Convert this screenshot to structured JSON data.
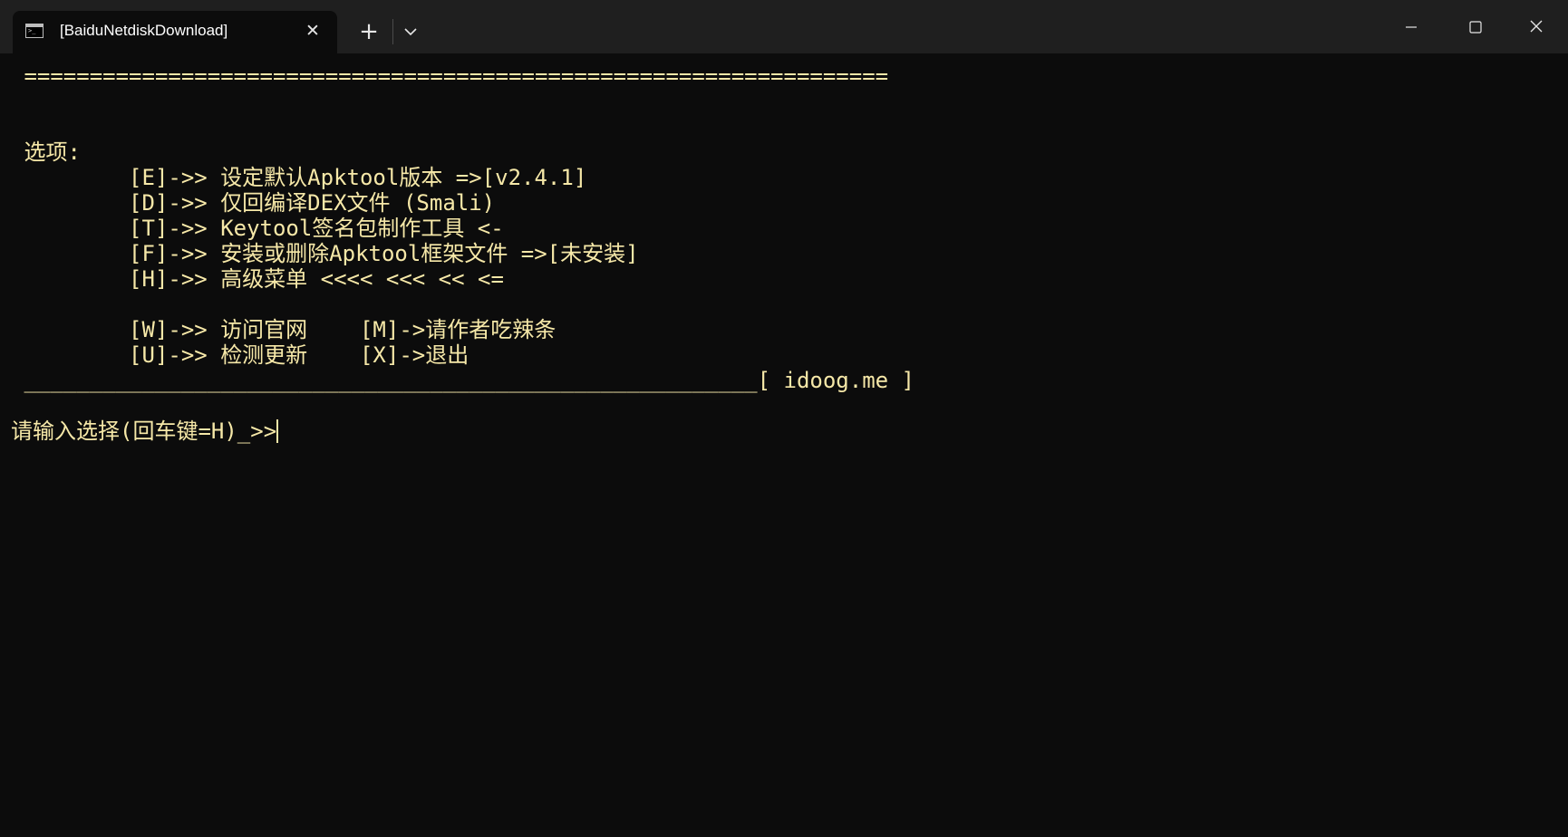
{
  "window": {
    "tab_title": "[BaiduNetdiskDownload]",
    "tab_icon": "terminal-icon",
    "tab_close_glyph": "✕",
    "new_tab_glyph": "+"
  },
  "terminal": {
    "lines": [
      " ==================================================================",
      "",
      "",
      " 选项:",
      "         [E]->> 设定默认Apktool版本 =>[v2.4.1]",
      "         [D]->> 仅回编译DEX文件 (Smali)",
      "         [T]->> Keytool签名包制作工具 <-",
      "         [F]->> 安装或删除Apktool框架文件 =>[未安装]",
      "         [H]->> 高级菜单 <<<< <<< << <=",
      "",
      "         [W]->> 访问官网    [M]->请作者吃辣条",
      "         [U]->> 检测更新    [X]->退出",
      " ________________________________________________________[ idoog.me ]",
      ""
    ],
    "prompt": "请输入选择(回车键=H)_>>"
  },
  "colors": {
    "text": "#f6e8a8",
    "background": "#0c0c0c",
    "titlebar": "#1f1f1f"
  }
}
